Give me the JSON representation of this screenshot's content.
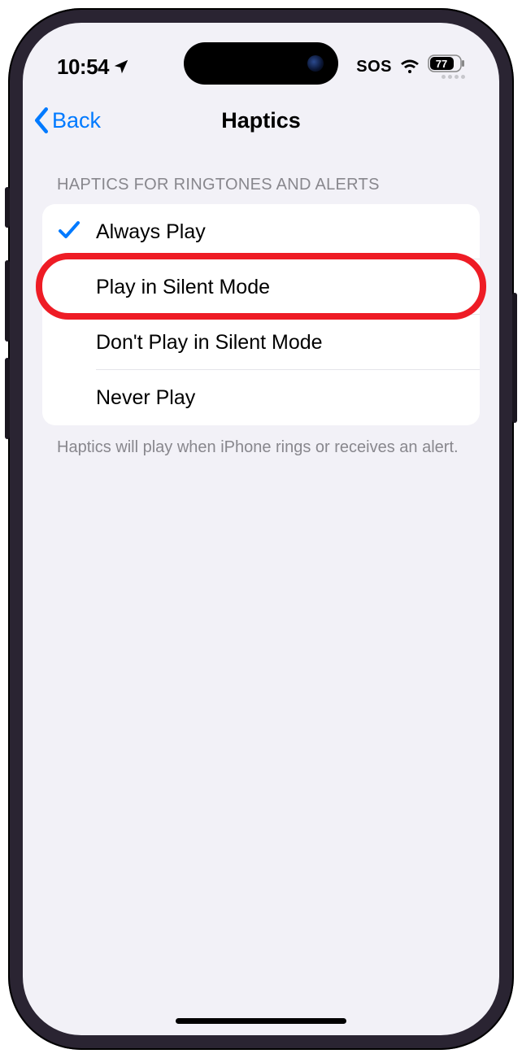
{
  "status": {
    "time": "10:54",
    "sos": "SOS",
    "battery": "77"
  },
  "nav": {
    "back": "Back",
    "title": "Haptics"
  },
  "section": {
    "header": "HAPTICS FOR RINGTONES AND ALERTS",
    "footer": "Haptics will play when iPhone rings or receives an alert.",
    "options": [
      {
        "label": "Always Play",
        "selected": true
      },
      {
        "label": "Play in Silent Mode",
        "selected": false
      },
      {
        "label": "Don't Play in Silent Mode",
        "selected": false
      },
      {
        "label": "Never Play",
        "selected": false
      }
    ]
  }
}
